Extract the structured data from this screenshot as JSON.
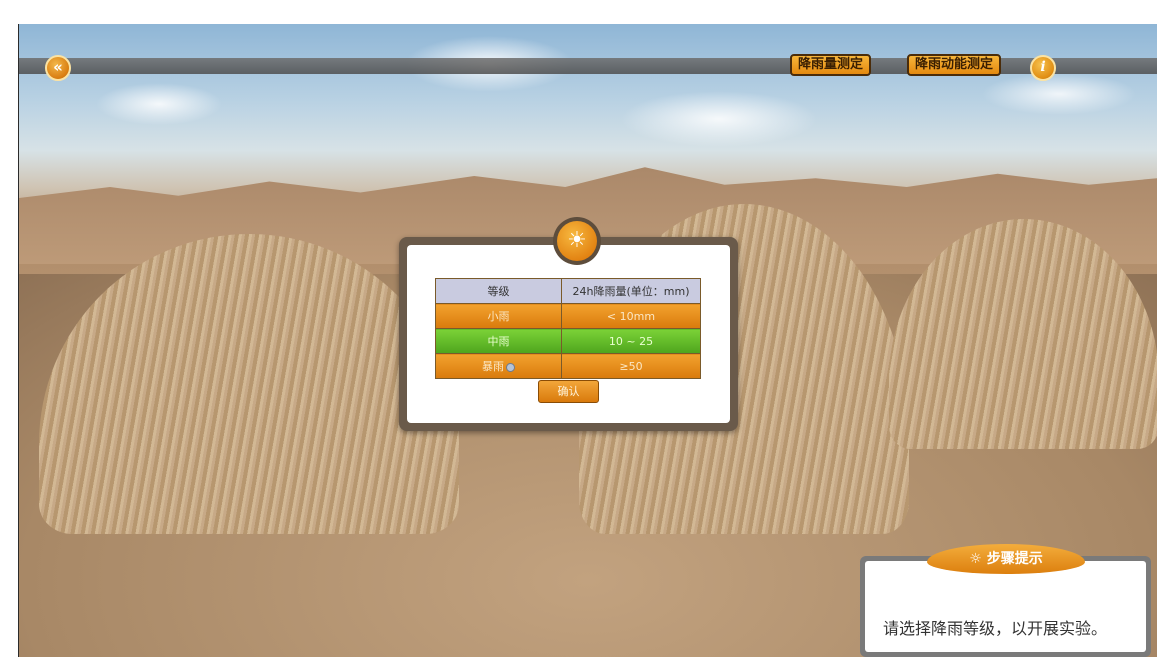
{
  "toolbar": {
    "back_icon": "«",
    "rainfall_measure_label": "降雨量测定",
    "rainfall_kinetic_label": "降雨动能测定",
    "info_icon": "i"
  },
  "dialog": {
    "bulb_icon": "☀",
    "table": {
      "headers": [
        "等级",
        "24h降雨量(单位：mm)"
      ],
      "rows": [
        {
          "level": "小雨",
          "amount": "< 10mm",
          "color": "#e58a14"
        },
        {
          "level": "中雨",
          "amount": "10 ~ 25",
          "color": "#5fb826"
        },
        {
          "level": "暴雨",
          "amount": "≥50",
          "color": "#e58a14"
        }
      ]
    },
    "confirm_label": "确认"
  },
  "hint": {
    "tab_label": "☼ 步骤提示",
    "message": "请选择降雨等级，以开展实验。"
  }
}
